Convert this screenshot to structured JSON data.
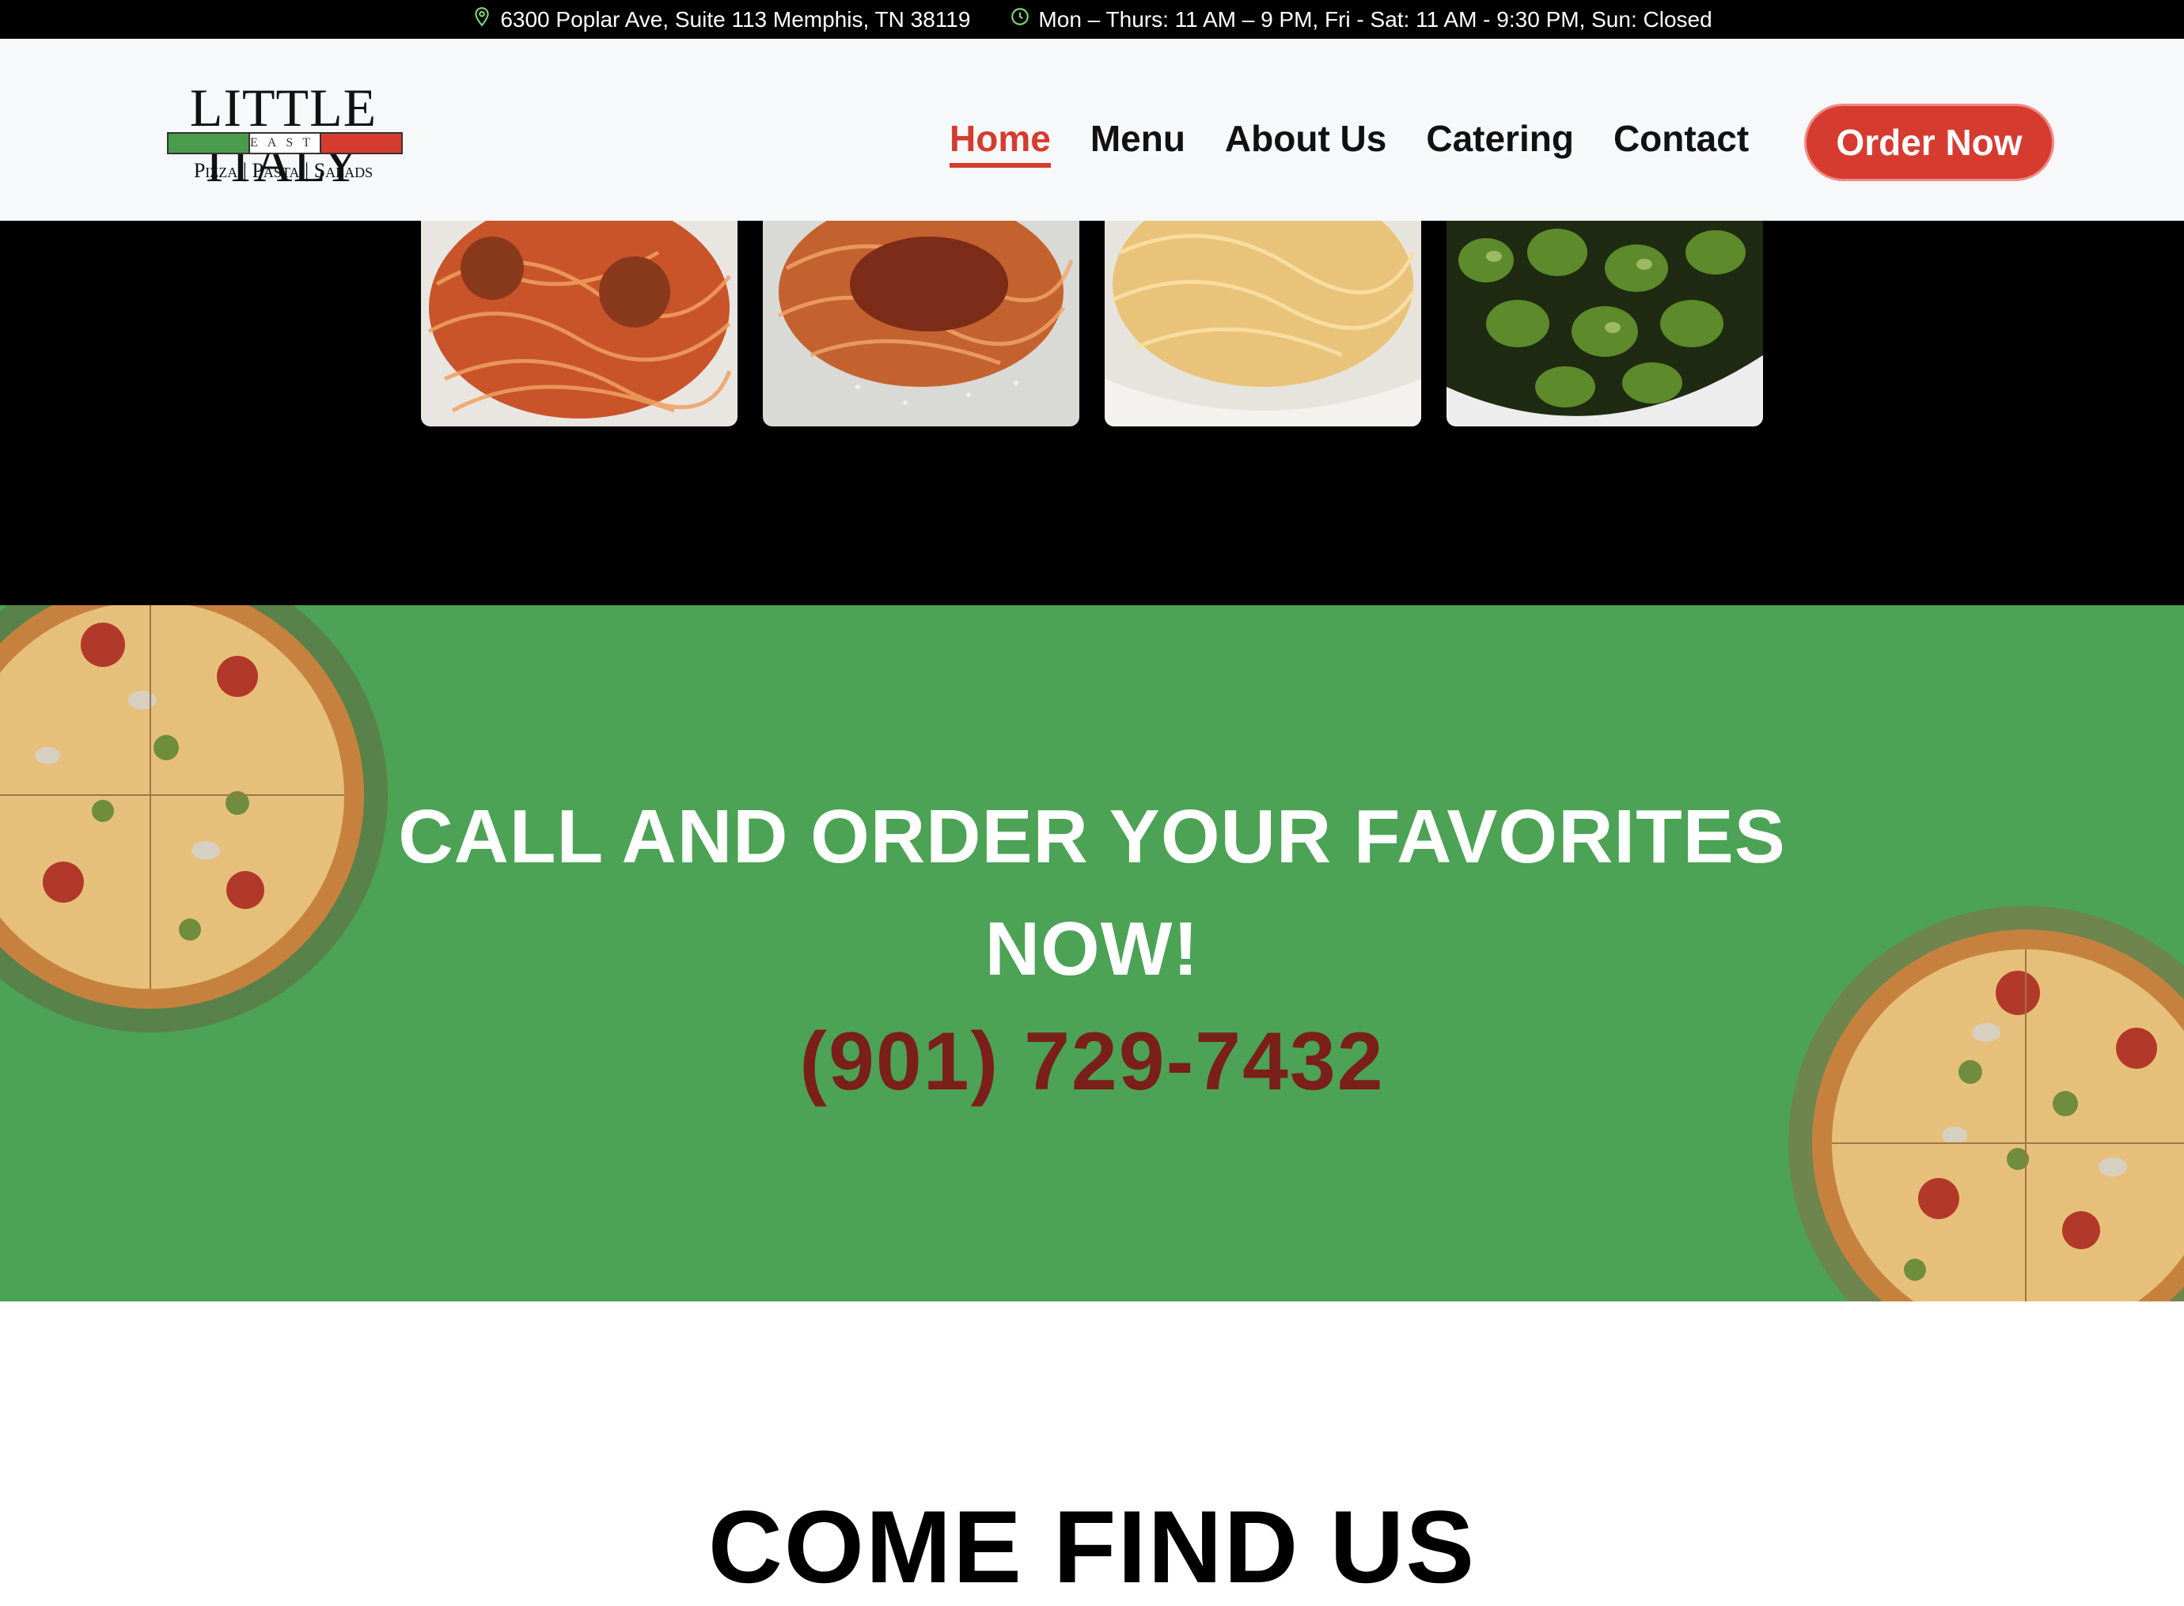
{
  "topbar": {
    "address": "6300 Poplar Ave, Suite 113 Memphis, TN 38119",
    "hours": "Mon – Thurs: 11 AM – 9 PM, Fri - Sat: 11 AM - 9:30 PM, Sun: Closed",
    "icons": [
      "location-pin-icon",
      "clock-icon"
    ],
    "icon_color": "#7dd37f"
  },
  "logo": {
    "name": "LITTLE ITALY",
    "sub": "EAST",
    "tagline": "Pizza | Pasta | Salads"
  },
  "nav": {
    "items": [
      "Home",
      "Menu",
      "About Us",
      "Catering",
      "Contact"
    ],
    "active": "Home",
    "order_label": "Order Now"
  },
  "gallery": {
    "images": [
      "spaghetti-meatballs-image",
      "spaghetti-bolognese-image",
      "spaghetti-carbonara-image",
      "gnocchi-pesto-image"
    ]
  },
  "callout": {
    "heading_line1": "CALL AND ORDER YOUR FAVORITES",
    "heading_line2": "NOW!",
    "phone": "(901) 729-7432"
  },
  "find": {
    "heading": "COME FIND US"
  },
  "colors": {
    "accent": "#d63b30",
    "green": "#4ca255",
    "phone": "#7a1f1a"
  }
}
